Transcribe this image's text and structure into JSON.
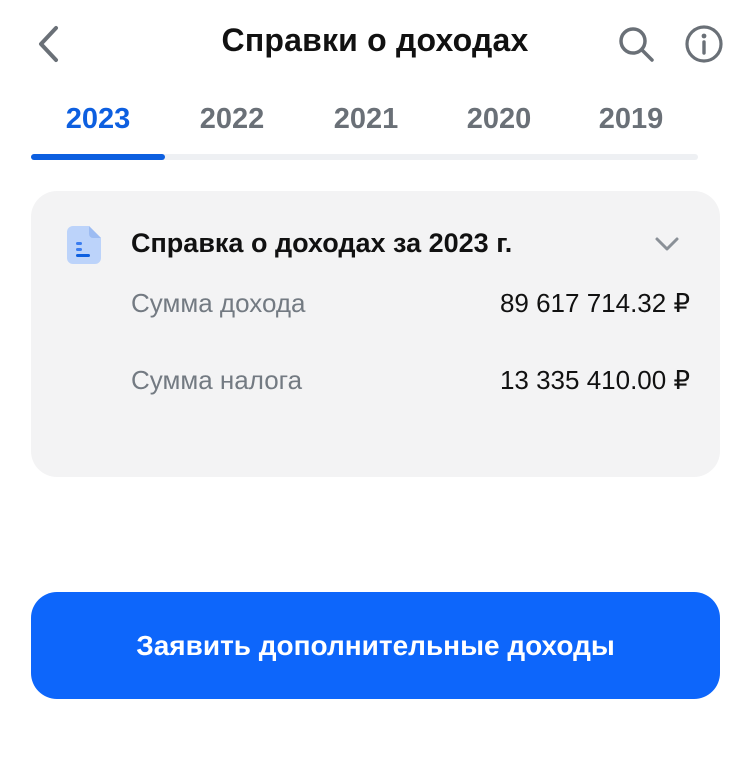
{
  "header": {
    "title": "Справки о доходах",
    "back_icon": "chevron-left-icon",
    "search_icon": "search-icon",
    "info_icon": "info-icon"
  },
  "tabs": [
    {
      "label": "2023",
      "active": true
    },
    {
      "label": "2022",
      "active": false
    },
    {
      "label": "2021",
      "active": false
    },
    {
      "label": "2020",
      "active": false
    },
    {
      "label": "2019",
      "active": false
    }
  ],
  "card": {
    "icon": "document-icon",
    "title": "Справка о доходах за 2023 г.",
    "expand_icon": "chevron-down-icon",
    "rows": [
      {
        "label": "Сумма дохода",
        "value": "89 617 714.32 ₽"
      },
      {
        "label": "Сумма налога",
        "value": "13 335 410.00 ₽"
      }
    ]
  },
  "actions": {
    "declare_label": "Заявить дополнительные доходы"
  },
  "colors": {
    "accent": "#0d66fb",
    "tab_active": "#0d5fe0",
    "card_bg": "#f3f3f4",
    "muted_text": "#737a82"
  }
}
